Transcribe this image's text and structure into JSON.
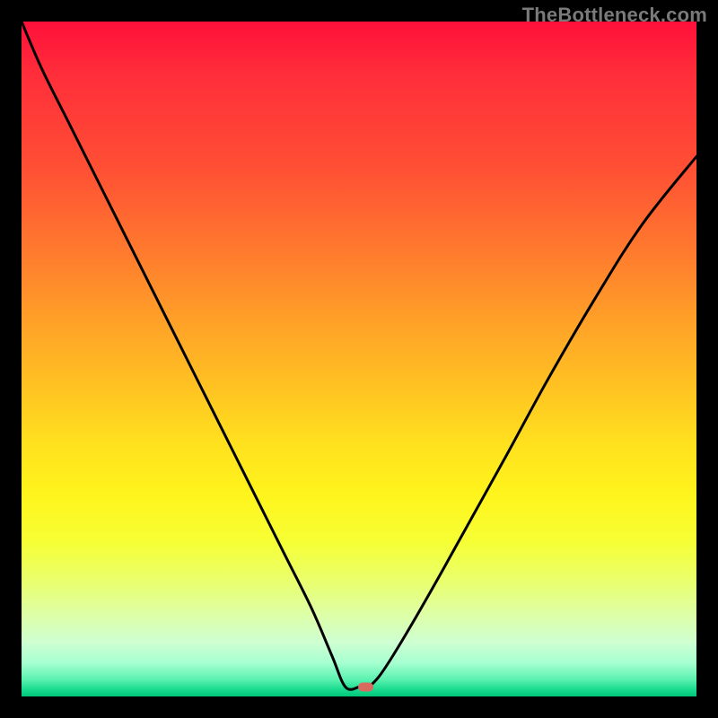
{
  "watermark": "TheBottleneck.com",
  "colors": {
    "border": "#000000",
    "curve": "#000000",
    "marker": "#d96a60",
    "gradient_stops": [
      "#ff103a",
      "#ff2e3a",
      "#ff5034",
      "#ff7a2e",
      "#ff9f28",
      "#ffc222",
      "#ffe21e",
      "#fff41c",
      "#f6ff34",
      "#e9ff6e",
      "#ddffa8",
      "#cfffd2",
      "#a6ffd0",
      "#5bf2b0",
      "#17d98d",
      "#00c77a"
    ]
  },
  "chart_data": {
    "type": "line",
    "title": "",
    "xlabel": "",
    "ylabel": "",
    "xlim": [
      0,
      100
    ],
    "ylim": [
      0,
      100
    ],
    "series": [
      {
        "name": "curve-left",
        "x": [
          0,
          3,
          7,
          12,
          17,
          22,
          27,
          31,
          35,
          39,
          43,
          46,
          48,
          50
        ],
        "y": [
          100,
          93,
          85,
          75,
          65,
          55,
          45,
          37,
          29,
          21,
          13,
          6,
          1.4,
          1.4
        ]
      },
      {
        "name": "curve-right",
        "x": [
          51.5,
          53,
          55,
          58,
          62,
          67,
          72,
          78,
          85,
          92,
          100
        ],
        "y": [
          1.4,
          3,
          6,
          11,
          18,
          27,
          36,
          47,
          59,
          70,
          80
        ]
      }
    ],
    "marker": {
      "x": 51,
      "y": 1.4
    }
  }
}
